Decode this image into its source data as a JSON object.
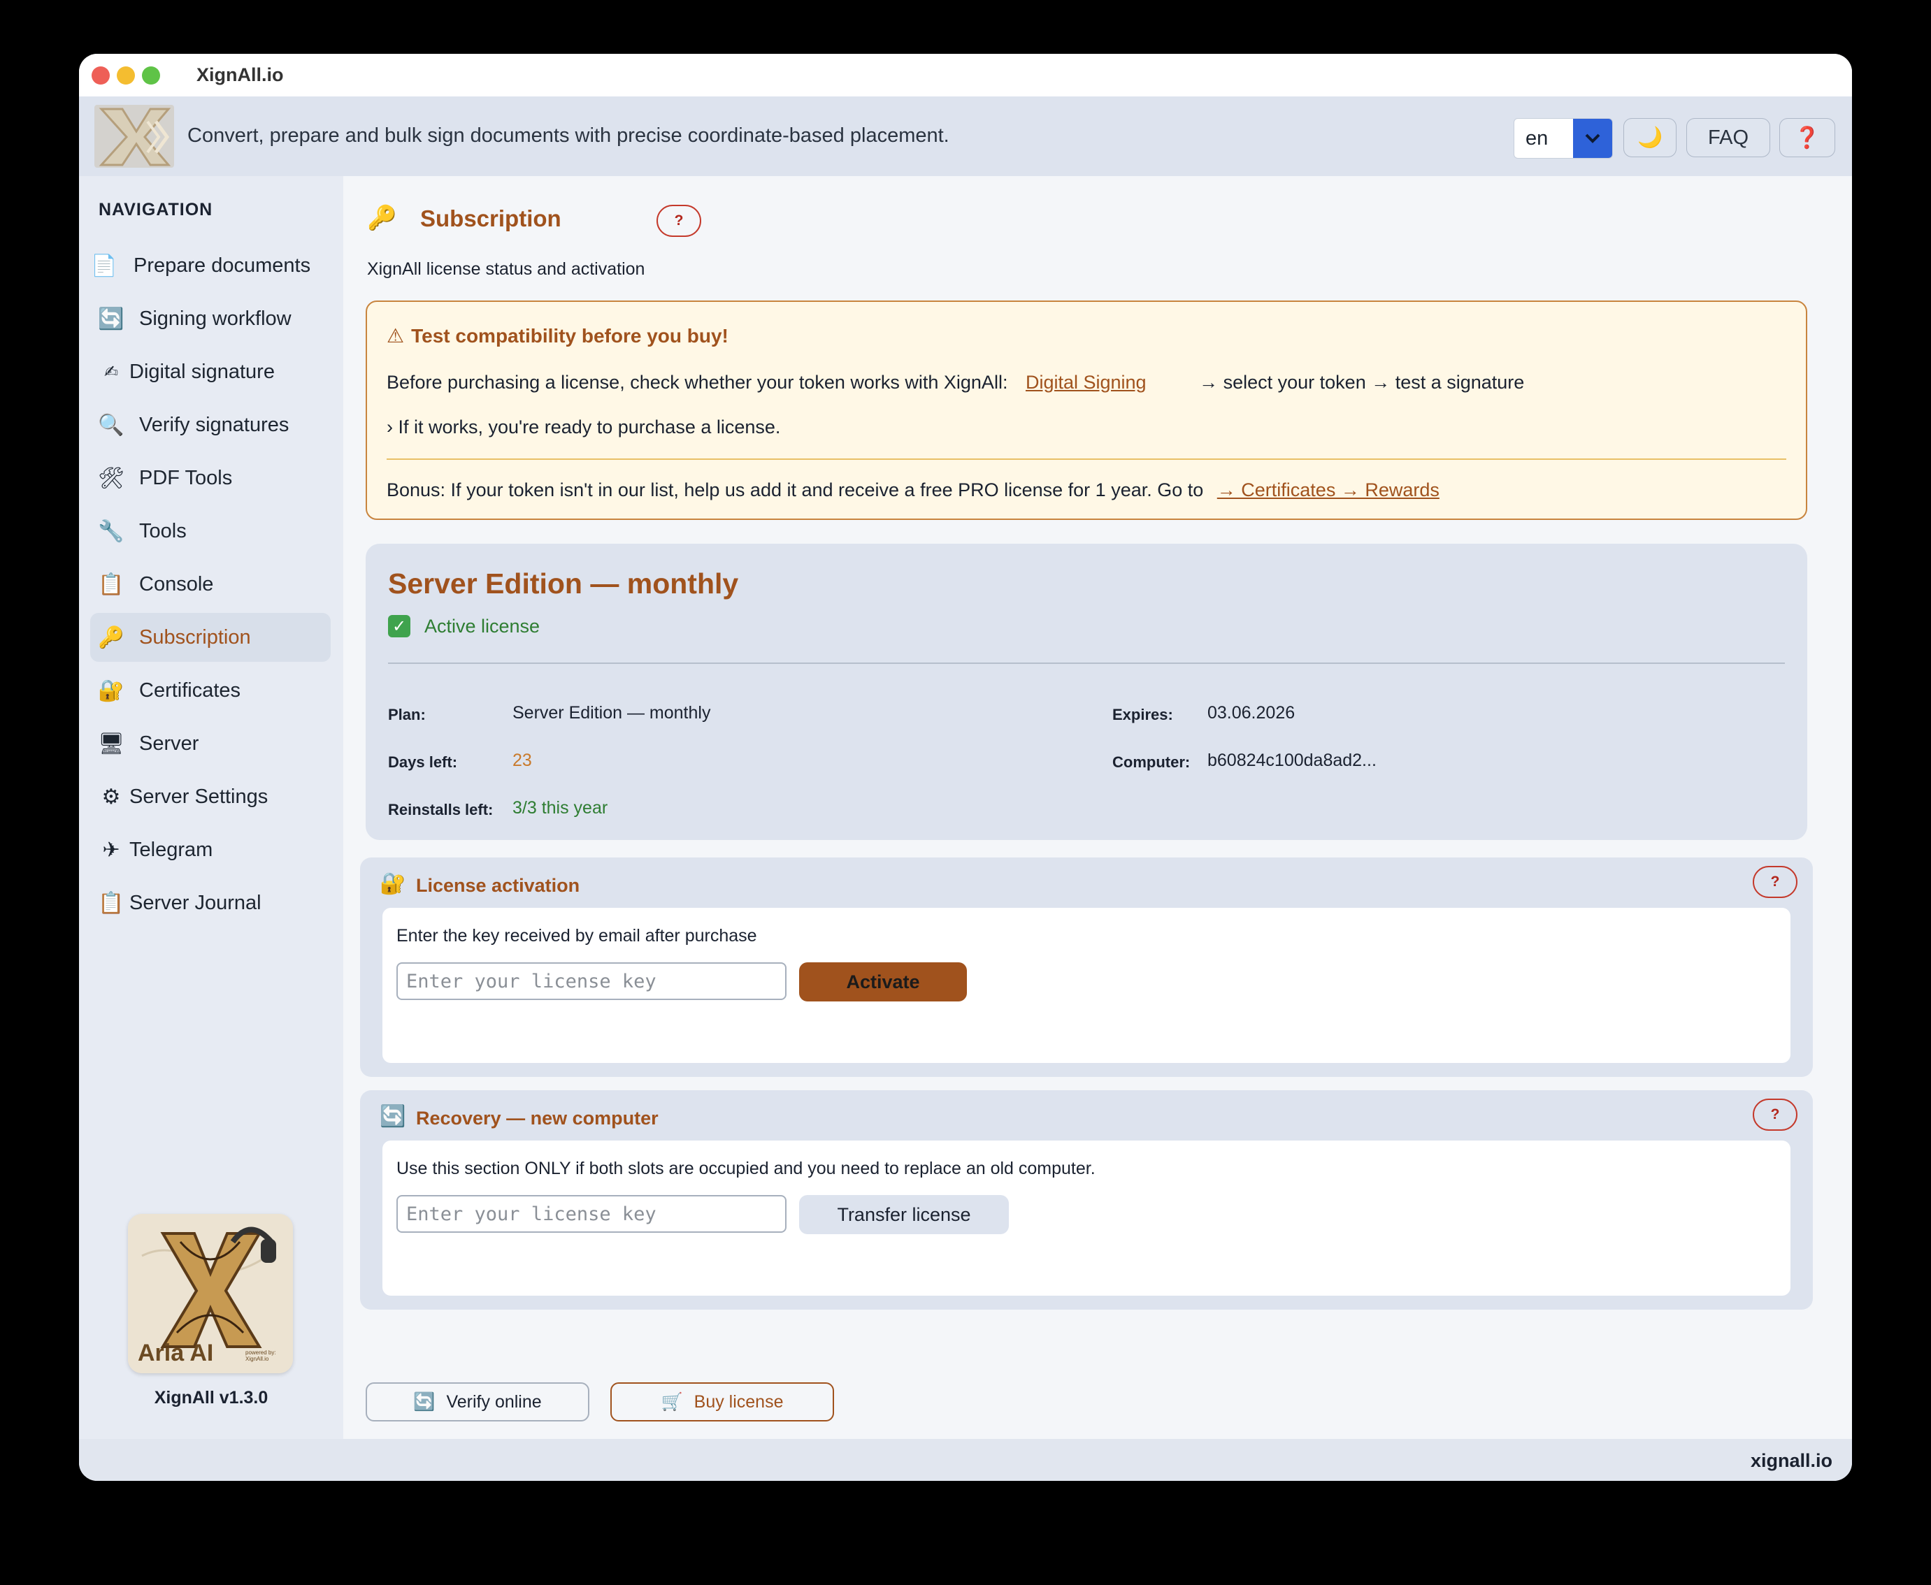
{
  "window": {
    "title": "XignAll.io"
  },
  "header": {
    "tagline": "Convert, prepare and bulk sign documents with precise coordinate-based placement.",
    "language": "en",
    "theme_icon": "moon-icon",
    "faq_label": "FAQ",
    "help_label": "❓"
  },
  "sidebar": {
    "title": "NAVIGATION",
    "items": [
      {
        "label": "Prepare documents",
        "icon": "document-icon"
      },
      {
        "label": "Signing workflow",
        "icon": "refresh-icon"
      },
      {
        "label": "Digital signature",
        "icon": "signature-icon"
      },
      {
        "label": "Verify signatures",
        "icon": "magnifier-icon"
      },
      {
        "label": "PDF Tools",
        "icon": "tools-icon"
      },
      {
        "label": "Tools",
        "icon": "wrench-icon"
      },
      {
        "label": "Console",
        "icon": "clipboard-icon"
      },
      {
        "label": "Subscription",
        "icon": "key-icon",
        "active": true
      },
      {
        "label": "Certificates",
        "icon": "lock-icon"
      },
      {
        "label": "Server",
        "icon": "monitor-icon"
      },
      {
        "label": "Server Settings",
        "icon": "gear-icon"
      },
      {
        "label": "Telegram",
        "icon": "airplane-icon"
      },
      {
        "label": "Server Journal",
        "icon": "clipboard-icon"
      }
    ],
    "aria_name": "Aria AI",
    "aria_powered": "powered by: XignAll.io",
    "version": "XignAll v1.3.0"
  },
  "page": {
    "title": "Subscription",
    "help": "?",
    "subtitle": "XignAll license status and activation"
  },
  "warning": {
    "title": "Test compatibility before you buy!",
    "line1_text": "Before purchasing a license, check whether your token works with XignAll:",
    "line1_link": "Digital Signing",
    "line1_after": "→ select your token → test a signature",
    "line2": "› If it works, you're ready to purchase a license.",
    "bonus_text": "Bonus: If your token isn't in our list, help us add it and receive a free PRO license for 1 year. Go to",
    "bonus_link": "→ Certificates → Rewards"
  },
  "license": {
    "name": "Server Edition — monthly",
    "status": "Active license",
    "plan_label": "Plan:",
    "plan_value": "Server Edition — monthly",
    "expires_label": "Expires:",
    "expires_value": "03.06.2026",
    "days_label": "Days left:",
    "days_value": "23",
    "computer_label": "Computer:",
    "computer_value": "b60824c100da8ad2...",
    "reinstalls_label": "Reinstalls left:",
    "reinstalls_value": "3/3 this year",
    "colors": {
      "accent": "#a0521d",
      "ok": "#2e7d32",
      "days": "#c97a2b"
    }
  },
  "activation": {
    "title": "License activation",
    "help": "?",
    "desc": "Enter the key received by email after purchase",
    "placeholder": "Enter your license key",
    "button": "Activate"
  },
  "recovery": {
    "title": "Recovery — new computer",
    "help": "?",
    "desc": "Use this section ONLY if both slots are occupied and you need to replace an old computer.",
    "placeholder": "Enter your license key",
    "button": "Transfer license"
  },
  "actions": {
    "verify": "Verify online",
    "buy": "Buy license"
  },
  "footer": {
    "site": "xignall.io"
  }
}
